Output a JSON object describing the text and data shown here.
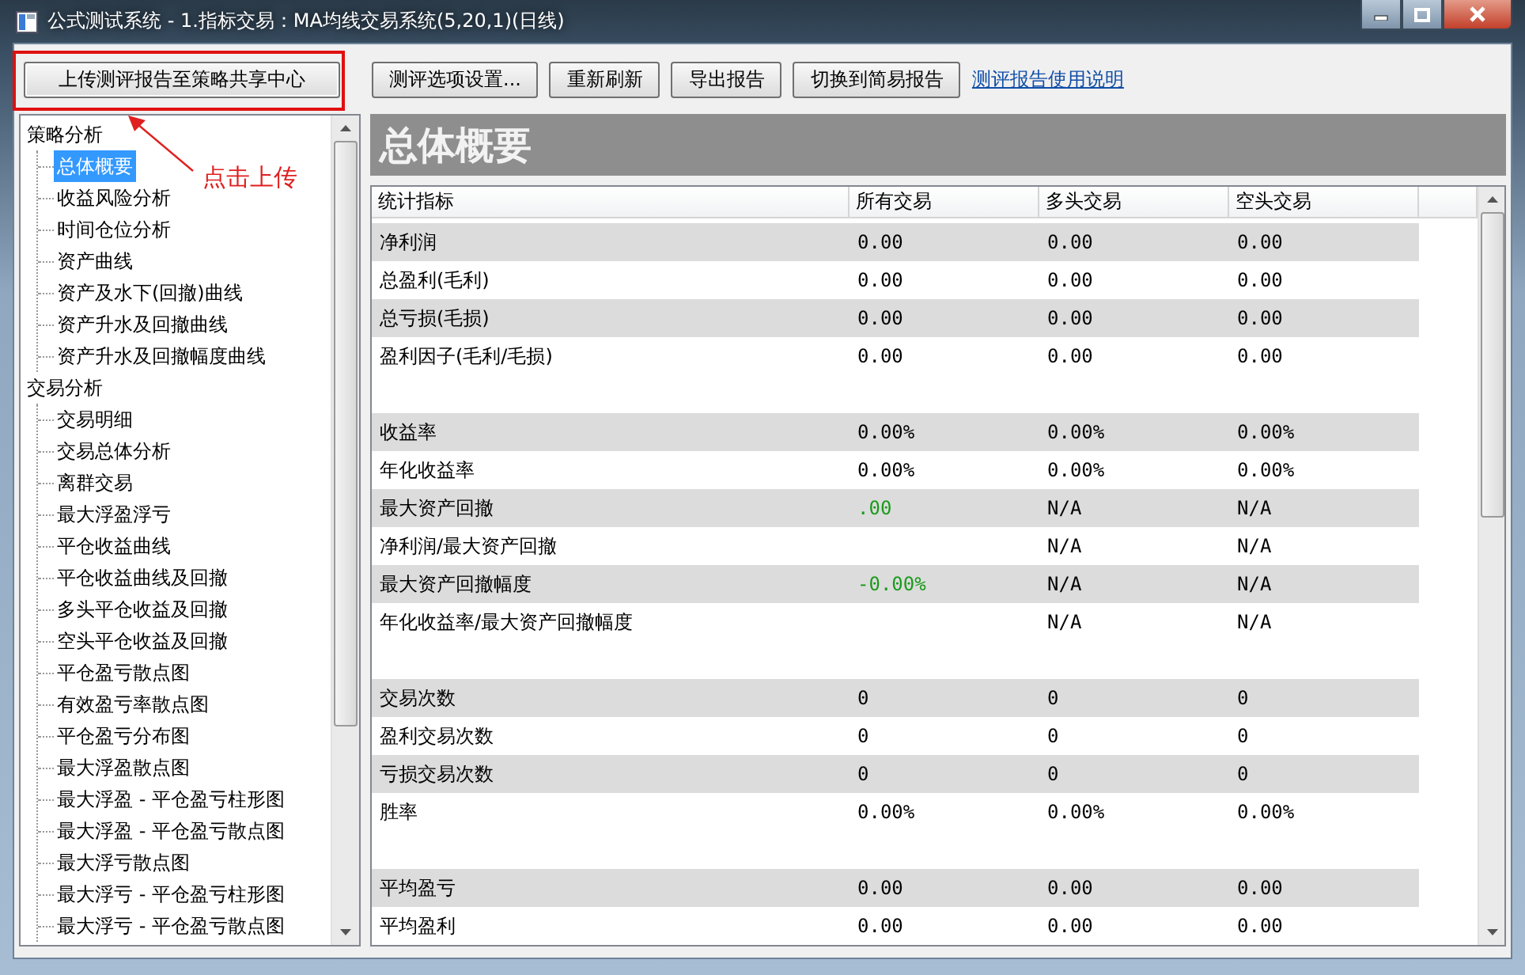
{
  "window": {
    "title": "公式测试系统 - 1.指标交易：MA均线交易系统(5,20,1)(日线)"
  },
  "toolbar": {
    "buttons": [
      {
        "label": "上传测评报告至策略共享中心",
        "highlighted": true
      },
      {
        "label": "测评选项设置...",
        "highlighted": false
      },
      {
        "label": "重新刷新",
        "highlighted": false
      },
      {
        "label": "导出报告",
        "highlighted": false
      },
      {
        "label": "切换到简易报告",
        "highlighted": false
      }
    ],
    "link": "测评报告使用说明"
  },
  "annotation": {
    "text": "点击上传"
  },
  "tree": {
    "groups": [
      {
        "label": "策略分析",
        "selected": false,
        "children": [
          {
            "label": "总体概要",
            "selected": true
          },
          {
            "label": "收益风险分析",
            "selected": false
          },
          {
            "label": "时间仓位分析",
            "selected": false
          },
          {
            "label": "资产曲线",
            "selected": false
          },
          {
            "label": "资产及水下(回撤)曲线",
            "selected": false
          },
          {
            "label": "资产升水及回撤曲线",
            "selected": false
          },
          {
            "label": "资产升水及回撤幅度曲线",
            "selected": false
          }
        ]
      },
      {
        "label": "交易分析",
        "selected": false,
        "children": [
          {
            "label": "交易明细",
            "selected": false
          },
          {
            "label": "交易总体分析",
            "selected": false
          },
          {
            "label": "离群交易",
            "selected": false
          },
          {
            "label": "最大浮盈浮亏",
            "selected": false
          },
          {
            "label": "平仓收益曲线",
            "selected": false
          },
          {
            "label": "平仓收益曲线及回撤",
            "selected": false
          },
          {
            "label": "多头平仓收益及回撤",
            "selected": false
          },
          {
            "label": "空头平仓收益及回撤",
            "selected": false
          },
          {
            "label": "平仓盈亏散点图",
            "selected": false
          },
          {
            "label": "有效盈亏率散点图",
            "selected": false
          },
          {
            "label": "平仓盈亏分布图",
            "selected": false
          },
          {
            "label": "最大浮盈散点图",
            "selected": false
          },
          {
            "label": "最大浮盈 - 平仓盈亏柱形图",
            "selected": false
          },
          {
            "label": "最大浮盈 - 平仓盈亏散点图",
            "selected": false
          },
          {
            "label": "最大浮亏散点图",
            "selected": false
          },
          {
            "label": "最大浮亏 - 平仓盈亏柱形图",
            "selected": false
          },
          {
            "label": "最大浮亏 - 平仓盈亏散点图",
            "selected": false
          }
        ]
      }
    ]
  },
  "report": {
    "title": "总体概要",
    "table": {
      "columns": [
        "统计指标",
        "所有交易",
        "多头交易",
        "空头交易"
      ],
      "groups": [
        {
          "rows": [
            {
              "label": "净利润",
              "all": "0.00",
              "long": "0.00",
              "short": "0.00"
            },
            {
              "label": "总盈利(毛利)",
              "all": "0.00",
              "long": "0.00",
              "short": "0.00"
            },
            {
              "label": "总亏损(毛损)",
              "all": "0.00",
              "long": "0.00",
              "short": "0.00"
            },
            {
              "label": "盈利因子(毛利/毛损)",
              "all": "0.00",
              "long": "0.00",
              "short": "0.00"
            }
          ]
        },
        {
          "rows": [
            {
              "label": "收益率",
              "all": "0.00%",
              "long": "0.00%",
              "short": "0.00%"
            },
            {
              "label": "年化收益率",
              "all": "0.00%",
              "long": "0.00%",
              "short": "0.00%"
            },
            {
              "label": "最大资产回撤",
              "all": {
                "text": ".00",
                "color": "#1a9a1a"
              },
              "long": "N/A",
              "short": "N/A"
            },
            {
              "label": "净利润/最大资产回撤",
              "long": "N/A",
              "short": "N/A"
            },
            {
              "label": "最大资产回撤幅度",
              "all": {
                "text": "-0.00%",
                "color": "#1a9a1a"
              },
              "long": "N/A",
              "short": "N/A"
            },
            {
              "label": "年化收益率/最大资产回撤幅度",
              "long": "N/A",
              "short": "N/A"
            }
          ]
        },
        {
          "rows": [
            {
              "label": "交易次数",
              "all": "0",
              "long": "0",
              "short": "0"
            },
            {
              "label": "盈利交易次数",
              "all": "0",
              "long": "0",
              "short": "0"
            },
            {
              "label": "亏损交易次数",
              "all": "0",
              "long": "0",
              "short": "0"
            },
            {
              "label": "胜率",
              "all": "0.00%",
              "long": "0.00%",
              "short": "0.00%"
            }
          ]
        },
        {
          "rows": [
            {
              "label": "平均盈亏",
              "all": "0.00",
              "long": "0.00",
              "short": "0.00"
            },
            {
              "label": "平均盈利",
              "all": "0.00",
              "long": "0.00",
              "short": "0.00"
            }
          ]
        }
      ]
    }
  }
}
